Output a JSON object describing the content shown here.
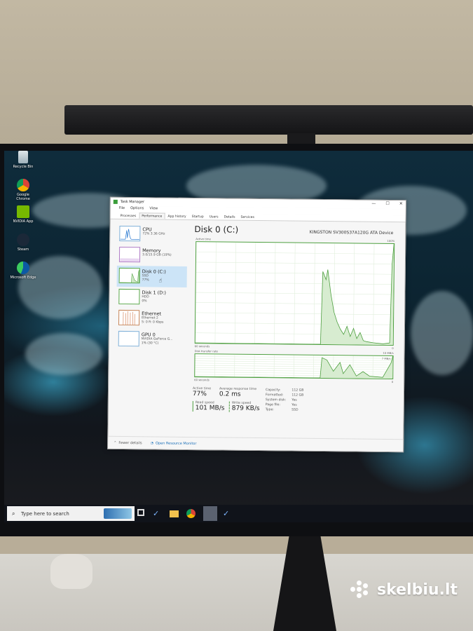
{
  "desktop": {
    "icons": [
      {
        "label": "Recycle Bin"
      },
      {
        "label": "Google Chrome"
      },
      {
        "label": "NVIDIA App"
      },
      {
        "label": "Steam"
      },
      {
        "label": "Microsoft Edge"
      }
    ]
  },
  "window": {
    "title": "Task Manager",
    "menu": [
      "File",
      "Options",
      "View"
    ],
    "tabs": [
      "Processes",
      "Performance",
      "App history",
      "Startup",
      "Users",
      "Details",
      "Services"
    ],
    "active_tab": "Performance"
  },
  "sidebar": {
    "items": [
      {
        "name": "CPU",
        "line1": "72% 3.36 GHz",
        "line2": ""
      },
      {
        "name": "Memory",
        "line1": "3.0/15.9 GB (19%)",
        "line2": ""
      },
      {
        "name": "Disk 0 (C:)",
        "line1": "SSD",
        "line2": "77%"
      },
      {
        "name": "Disk 1 (D:)",
        "line1": "HDD",
        "line2": "0%"
      },
      {
        "name": "Ethernet",
        "line1": "Ethernet 2",
        "line2": "S: 0 R: 0 Kbps"
      },
      {
        "name": "GPU 0",
        "line1": "NVIDIA GeForce G...",
        "line2": "1% (30 °C)"
      }
    ]
  },
  "main": {
    "title": "Disk 0 (C:)",
    "model": "KINGSTON SV300S37A120G ATA Device",
    "active_time_label": "Active time",
    "active_time_max": "100%",
    "chart_span": "60 seconds",
    "chart_zero": "0",
    "transfer_label": "Disk transfer rate",
    "transfer_max": "10 MB/s",
    "transfer_inner": "7 MB/s",
    "stats": {
      "active_time_lbl": "Active time",
      "active_time_val": "77%",
      "resp_lbl": "Average response time",
      "resp_val": "0.2 ms",
      "read_lbl": "Read speed",
      "read_val": "101 MB/s",
      "write_lbl": "Write speed",
      "write_val": "879 KB/s"
    },
    "props": [
      {
        "k": "Capacity:",
        "v": "112 GB"
      },
      {
        "k": "Formatted:",
        "v": "112 GB"
      },
      {
        "k": "System disk:",
        "v": "Yes"
      },
      {
        "k": "Page file:",
        "v": "Yes"
      },
      {
        "k": "Type:",
        "v": "SSD"
      }
    ]
  },
  "footer": {
    "fewer": "Fewer details",
    "orm": "Open Resource Monitor"
  },
  "taskbar": {
    "search_placeholder": "Type here to search"
  },
  "watermark": "skelbiu.lt",
  "chart_data": [
    {
      "type": "area",
      "title": "Active time",
      "x": [
        0,
        2,
        4,
        6,
        8,
        10,
        12,
        14,
        16,
        18,
        20,
        22,
        24,
        26,
        28,
        30,
        32,
        34,
        36,
        38,
        40,
        42,
        44,
        46,
        48,
        50,
        52,
        54,
        56,
        58,
        60
      ],
      "values": [
        0,
        0,
        0,
        0,
        0,
        0,
        0,
        0,
        0,
        0,
        0,
        0,
        0,
        0,
        0,
        0,
        0,
        0,
        0,
        0,
        0,
        0,
        0,
        0,
        0,
        0,
        0,
        0,
        0,
        0,
        0
      ],
      "visible_series": [
        {
          "x": 0,
          "y": 0
        },
        {
          "x": 38,
          "y": 0
        },
        {
          "x": 38.5,
          "y": 72
        },
        {
          "x": 39.5,
          "y": 64
        },
        {
          "x": 40,
          "y": 74
        },
        {
          "x": 41,
          "y": 50
        },
        {
          "x": 42,
          "y": 32
        },
        {
          "x": 43,
          "y": 22
        },
        {
          "x": 44,
          "y": 15
        },
        {
          "x": 45,
          "y": 10
        },
        {
          "x": 46,
          "y": 18
        },
        {
          "x": 47,
          "y": 8
        },
        {
          "x": 48,
          "y": 16
        },
        {
          "x": 49,
          "y": 6
        },
        {
          "x": 50,
          "y": 12
        },
        {
          "x": 51,
          "y": 4
        },
        {
          "x": 52,
          "y": 3
        },
        {
          "x": 54,
          "y": 2
        },
        {
          "x": 57,
          "y": 1
        },
        {
          "x": 59,
          "y": 2
        },
        {
          "x": 59.5,
          "y": 80
        },
        {
          "x": 60,
          "y": 100
        }
      ],
      "ylim": [
        0,
        100
      ]
    },
    {
      "type": "area",
      "title": "Disk transfer rate",
      "visible_series": [
        {
          "x": 0,
          "y": 0
        },
        {
          "x": 38,
          "y": 0
        },
        {
          "x": 38.5,
          "y": 9
        },
        {
          "x": 40,
          "y": 8
        },
        {
          "x": 42,
          "y": 3
        },
        {
          "x": 44,
          "y": 7
        },
        {
          "x": 45,
          "y": 2
        },
        {
          "x": 47,
          "y": 6
        },
        {
          "x": 49,
          "y": 1
        },
        {
          "x": 51,
          "y": 3
        },
        {
          "x": 53,
          "y": 1
        },
        {
          "x": 57,
          "y": 0.5
        },
        {
          "x": 59.5,
          "y": 7
        },
        {
          "x": 60,
          "y": 10
        }
      ],
      "ylim": [
        0,
        10
      ]
    }
  ]
}
